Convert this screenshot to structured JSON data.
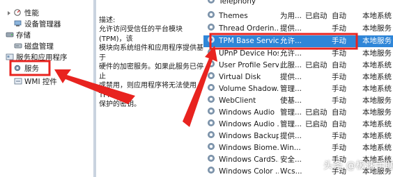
{
  "tree": {
    "items": [
      {
        "label": "性能",
        "icon": "performance-icon"
      },
      {
        "label": "设备管理器",
        "icon": "device-manager-icon"
      },
      {
        "label": "存储",
        "icon": "storage-icon"
      },
      {
        "label": "磁盘管理",
        "icon": "disk-management-icon"
      },
      {
        "label": "服务和应用程序",
        "icon": "services-apps-icon"
      },
      {
        "label": "服务",
        "icon": "services-icon"
      },
      {
        "label": "WMI 控件",
        "icon": "wmi-icon"
      }
    ]
  },
  "description": {
    "label": "描述:",
    "lines": [
      "允许访问受信任的平台模块(TPM)，该",
      "模块向系统组件和应用程序提供基于",
      "硬件的加密服务。如果此服务已停止",
      "或禁用，则应用程序将无法使用 TPM",
      "保护的密钥。"
    ]
  },
  "services": {
    "rows": [
      {
        "name": "Telephony",
        "desc": "",
        "status": "",
        "startup": "",
        "logon": ""
      },
      {
        "name": "Themes",
        "desc": "为用...",
        "status": "已启动",
        "startup": "自动",
        "logon": "本地系统"
      },
      {
        "name": "Thread Orderin...",
        "desc": "提供...",
        "status": "",
        "startup": "手动",
        "logon": "本地服务"
      },
      {
        "name": "TPM Base Servic...",
        "desc": "允许...",
        "status": "",
        "startup": "手动",
        "logon": "本地服务"
      },
      {
        "name": "UPnP Device Host",
        "desc": "允许...",
        "status": "",
        "startup": "手动",
        "logon": "本地服务"
      },
      {
        "name": "User Profile Serv...",
        "desc": "此服...",
        "status": "已启动",
        "startup": "自动",
        "logon": "本地系统"
      },
      {
        "name": "Virtual Disk",
        "desc": "提供...",
        "status": "",
        "startup": "手动",
        "logon": "本地系统"
      },
      {
        "name": "Volume Shadow...",
        "desc": "管理...",
        "status": "",
        "startup": "手动",
        "logon": "本地系统"
      },
      {
        "name": "WebClient",
        "desc": "使基...",
        "status": "",
        "startup": "手动",
        "logon": "本地服务"
      },
      {
        "name": "Windows Audio",
        "desc": "管理...",
        "status": "已启动",
        "startup": "自动",
        "logon": "本地服务"
      },
      {
        "name": "Windows Audio ...",
        "desc": "管理...",
        "status": "已启动",
        "startup": "自动",
        "logon": "本地系统"
      },
      {
        "name": "Windows Backup",
        "desc": "提供...",
        "status": "",
        "startup": "手动",
        "logon": "本地系统"
      },
      {
        "name": "Windows Biome...",
        "desc": "Win...",
        "status": "",
        "startup": "手动",
        "logon": "本地系统"
      },
      {
        "name": "Windows CardS...",
        "desc": "安全...",
        "status": "",
        "startup": "手动",
        "logon": "本地系统"
      },
      {
        "name": "Windows Color ...",
        "desc": "Wcs...",
        "status": "",
        "startup": "手动",
        "logon": "本地服务"
      }
    ]
  },
  "watermark": "头条 @极速手助",
  "colors": {
    "selection": "#2f86d8",
    "highlight_box": "#e8231f",
    "annotation_arrow": "#e8231f"
  }
}
